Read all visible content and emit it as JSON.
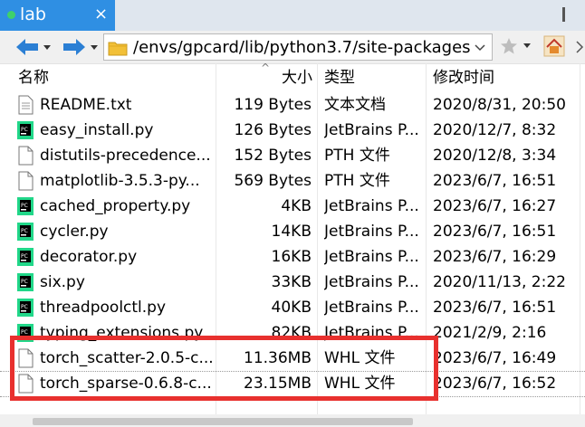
{
  "tab": {
    "title": "lab",
    "close": "×"
  },
  "toolbar": {
    "path": "/envs/gpcard/lib/python3.7/site-packages"
  },
  "columns": {
    "name": "名称",
    "size": "大小",
    "type": "类型",
    "date": "修改时间"
  },
  "files": [
    {
      "icon": "text-file-icon",
      "name": "README.txt",
      "size": "119 Bytes",
      "type": "文本文档",
      "date": "2020/8/31, 20:50"
    },
    {
      "icon": "pycharm-file-icon",
      "name": "easy_install.py",
      "size": "126 Bytes",
      "type": "JetBrains P...",
      "date": "2020/12/7, 8:32"
    },
    {
      "icon": "generic-file-icon",
      "name": "distutils-precedence...",
      "size": "152 Bytes",
      "type": "PTH 文件",
      "date": "2020/12/8, 3:34"
    },
    {
      "icon": "generic-file-icon",
      "name": "matplotlib-3.5.3-py...",
      "size": "569 Bytes",
      "type": "PTH 文件",
      "date": "2023/6/7, 16:51"
    },
    {
      "icon": "pycharm-file-icon",
      "name": "cached_property.py",
      "size": "4KB",
      "type": "JetBrains P...",
      "date": "2023/6/7, 16:27"
    },
    {
      "icon": "pycharm-file-icon",
      "name": "cycler.py",
      "size": "14KB",
      "type": "JetBrains P...",
      "date": "2023/6/7, 16:51"
    },
    {
      "icon": "pycharm-file-icon",
      "name": "decorator.py",
      "size": "16KB",
      "type": "JetBrains P...",
      "date": "2023/6/7, 16:29"
    },
    {
      "icon": "pycharm-file-icon",
      "name": "six.py",
      "size": "33KB",
      "type": "JetBrains P...",
      "date": "2020/11/13, 2:22"
    },
    {
      "icon": "pycharm-file-icon",
      "name": "threadpoolctl.py",
      "size": "40KB",
      "type": "JetBrains P...",
      "date": "2023/6/7, 16:51"
    },
    {
      "icon": "pycharm-file-icon",
      "name": "typing_extensions.py",
      "size": "82KB",
      "type": "JetBrains P...",
      "date": "2021/2/9, 2:16"
    },
    {
      "icon": "generic-file-icon",
      "name": "torch_scatter-2.0.5-c...",
      "size": "11.36MB",
      "type": "WHL 文件",
      "date": "2023/6/7, 16:49"
    },
    {
      "icon": "generic-file-icon",
      "name": "torch_sparse-0.6.8-c...",
      "size": "23.15MB",
      "type": "WHL 文件",
      "date": "2023/6/7, 16:52"
    }
  ],
  "colors": {
    "tab": "#2f8fe3",
    "highlight": "#e8302e",
    "pycharm": "#21d789"
  }
}
